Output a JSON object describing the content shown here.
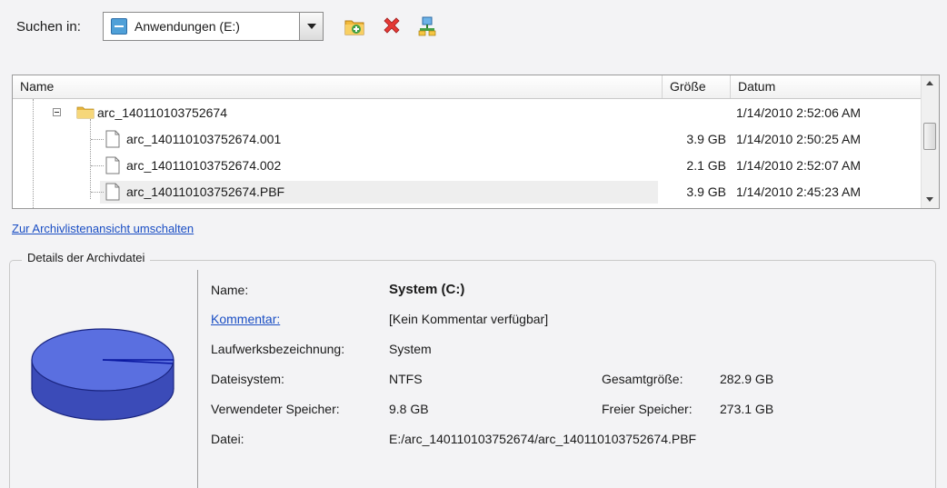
{
  "toolbar": {
    "search_in_label": "Suchen in:",
    "location_value": "Anwendungen (E:)",
    "icons": [
      "new-folder-icon",
      "delete-icon",
      "network-icon"
    ]
  },
  "file_list": {
    "columns": [
      "Name",
      "Größe",
      "Datum"
    ],
    "rows": [
      {
        "name": "arc_140110103752674",
        "size": "",
        "date": "1/14/2010 2:52:06 AM",
        "type": "folder"
      },
      {
        "name": "arc_140110103752674.001",
        "size": "3.9 GB",
        "date": "1/14/2010 2:50:25 AM",
        "type": "file"
      },
      {
        "name": "arc_140110103752674.002",
        "size": "2.1 GB",
        "date": "1/14/2010 2:52:07 AM",
        "type": "file"
      },
      {
        "name": "arc_140110103752674.PBF",
        "size": "3.9 GB",
        "date": "1/14/2010 2:45:23 AM",
        "type": "file",
        "selected": true
      }
    ]
  },
  "switch_link": "Zur Archivlistenansicht umschalten",
  "details": {
    "title": "Details der Archivdatei",
    "name_label": "Name:",
    "name_value": "System (C:)",
    "comment_label": "Kommentar:",
    "comment_value": "[Kein Kommentar verfügbar]",
    "volume_label": "Laufwerksbezeichnung:",
    "volume_value": "System",
    "filesystem_label": "Dateisystem:",
    "filesystem_value": "NTFS",
    "used_label": "Verwendeter Speicher:",
    "used_value": "9.8 GB",
    "file_label": "Datei:",
    "file_value": "E:/arc_140110103752674/arc_140110103752674.PBF",
    "total_label": "Gesamtgröße:",
    "total_value": "282.9 GB",
    "free_label": "Freier Speicher:",
    "free_value": "273.1 GB"
  },
  "colors": {
    "pie_fill": "#5a6fe0",
    "pie_used": "#1a2aa0",
    "link": "#1a4ec4"
  }
}
